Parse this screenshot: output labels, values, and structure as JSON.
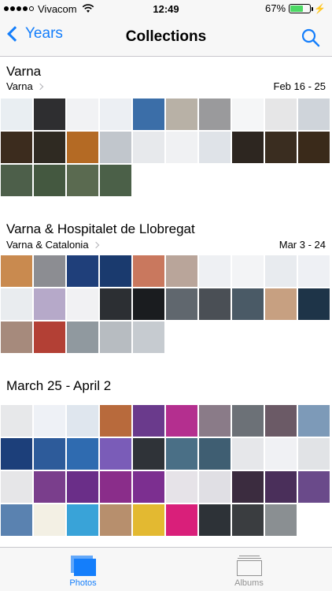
{
  "status": {
    "carrier": "Vivacom",
    "time": "12:49",
    "battery": "67%",
    "battery_level": 0.67
  },
  "nav": {
    "back_label": "Years",
    "title": "Collections",
    "search_icon": "search-icon"
  },
  "collections": [
    {
      "title": "Varna",
      "subtitle": "Varna",
      "date": "Feb 16 - 25",
      "photos": [
        "#e9eef2",
        "#2e2e30",
        "#f1f2f4",
        "#eceff3",
        "#3b6ea8",
        "#b8b1a6",
        "#9a9a9c",
        "#f5f6f7",
        "#e6e6e7",
        "#cfd4da",
        "#3c2c1e",
        "#2f2a22",
        "#b46a24",
        "#c1c6cc",
        "#e7e9ec",
        "#f0f1f3",
        "#dfe3e8",
        "#2d2620",
        "#3a2d20",
        "#3a2a1a",
        "#4d5f4a",
        "#445840",
        "#5a6a50",
        "#4b6048"
      ]
    },
    {
      "title": "Varna & Hospitalet de Llobregat",
      "subtitle": "Varna & Catalonia",
      "date": "Mar 3 - 24",
      "photos": [
        "#c98a4f",
        "#8c8d92",
        "#1f3f7a",
        "#1a3a6e",
        "#c9785e",
        "#b9a59a",
        "#eef0f3",
        "#f3f4f6",
        "#e8ebef",
        "#eef0f4",
        "#e9ecef",
        "#b6a9c9",
        "#f1f1f3",
        "#2c2f33",
        "#1a1c1f",
        "#60676e",
        "#4a4f55",
        "#4a5a66",
        "#c7a081",
        "#1e3448",
        "#a68a7c",
        "#b34035",
        "#90999f",
        "#b7bcc1",
        "#c6cbd0"
      ]
    },
    {
      "title": "March 25 - April 2",
      "subtitle": "",
      "date": "",
      "photos": [
        "#e7e8ea",
        "#eef1f6",
        "#dfe6ee",
        "#b86a3c",
        "#6a3a8c",
        "#b42f8f",
        "#8a7b88",
        "#6c7177",
        "#6b5a66",
        "#7d9ab8",
        "#1c3f7a",
        "#2d5b9a",
        "#2f6bb0",
        "#7a5cb8",
        "#2f3338",
        "#4a6f86",
        "#3f5e72",
        "#e6e7ea",
        "#f0f1f4",
        "#e1e3e6",
        "#e6e6e8",
        "#7a3e8c",
        "#6a2e88",
        "#8a2d8a",
        "#7c2f90",
        "#e6e3e8",
        "#e0dfe4",
        "#3b2c3f",
        "#4a2f5a",
        "#6a4a8a",
        "#5a82b0",
        "#f3f0e4",
        "#39a3d8",
        "#b78f6d",
        "#e3b931",
        "#d91f7a",
        "#2d3237",
        "#3a3d40",
        "#8a8f92"
      ]
    }
  ],
  "tabs": [
    {
      "label": "Photos",
      "active": true,
      "icon": "photos-icon"
    },
    {
      "label": "Albums",
      "active": false,
      "icon": "albums-icon"
    }
  ],
  "colors": {
    "accent": "#147efb",
    "inactive": "#929292",
    "bar_bg": "#f7f7f7"
  }
}
